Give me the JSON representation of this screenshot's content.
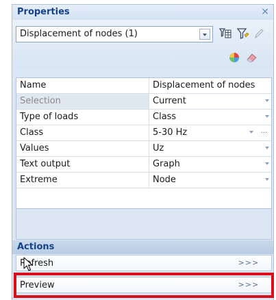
{
  "panel": {
    "title": "Properties",
    "close_glyph": "×",
    "selector": {
      "value": "Displacement of nodes (1)"
    },
    "toolbar_icons": [
      "table-filter-icon",
      "funnel-icon",
      "pencil-icon",
      "color-palette-icon",
      "eraser-icon"
    ]
  },
  "grid": {
    "rows": [
      {
        "name": "Name",
        "value": "Displacement of nodes",
        "dropdown": false,
        "ellipsis": false,
        "disabled": false
      },
      {
        "name": "Selection",
        "value": "Current",
        "dropdown": true,
        "ellipsis": false,
        "disabled": true
      },
      {
        "name": "Type of loads",
        "value": "Class",
        "dropdown": true,
        "ellipsis": false,
        "disabled": false
      },
      {
        "name": "Class",
        "value": "5-30 Hz",
        "dropdown": true,
        "ellipsis": true,
        "disabled": false
      },
      {
        "name": "Values",
        "value": "Uz",
        "dropdown": true,
        "ellipsis": false,
        "disabled": false
      },
      {
        "name": "Text output",
        "value": "Graph",
        "dropdown": true,
        "ellipsis": false,
        "disabled": false
      },
      {
        "name": "Extreme",
        "value": "Node",
        "dropdown": true,
        "ellipsis": false,
        "disabled": false
      }
    ],
    "ellipsis_glyph": "..."
  },
  "actions": {
    "title": "Actions",
    "items": [
      {
        "label": "Refresh",
        "go": ">>>"
      },
      {
        "label": "Preview",
        "go": ">>>"
      }
    ]
  },
  "colors": {
    "highlight": "#d80f19",
    "section_text": "#15428b",
    "panel_bg": "#dbe7f4"
  }
}
